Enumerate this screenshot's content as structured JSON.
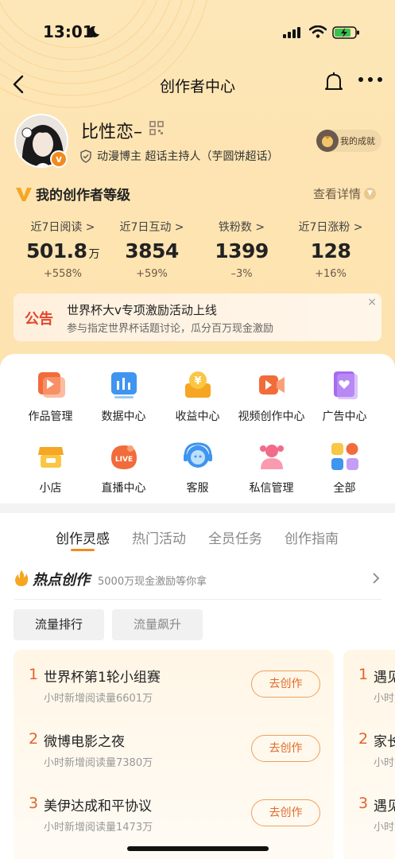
{
  "status_bar": {
    "time": "13:01"
  },
  "nav": {
    "title": "创作者中心"
  },
  "profile": {
    "username": "比性恋–",
    "verification": "动漫博主 超话主持人（芋圆饼超话）",
    "achievement": "我的成就",
    "avatar_badge": "v"
  },
  "level": {
    "title": "我的创作者等级",
    "detail": "查看详情"
  },
  "stats": [
    {
      "label": "近7日阅读 >",
      "value": "501.8",
      "unit": "万",
      "change": "+558%"
    },
    {
      "label": "近7日互动 >",
      "value": "3854",
      "unit": "",
      "change": "+59%"
    },
    {
      "label": "铁粉数 >",
      "value": "1399",
      "unit": "",
      "change": "–3%"
    },
    {
      "label": "近7日涨粉 >",
      "value": "128",
      "unit": "",
      "change": "+16%"
    }
  ],
  "notice": {
    "tag": "公告",
    "title": "世界杯大v专项激励活动上线",
    "subtitle": "参与指定世界杯话题讨论，瓜分百万现金激励",
    "close": "×"
  },
  "grid": [
    {
      "label": "作品管理",
      "icon": "works-icon"
    },
    {
      "label": "数据中心",
      "icon": "data-icon"
    },
    {
      "label": "收益中心",
      "icon": "income-icon"
    },
    {
      "label": "视频创作中心",
      "icon": "video-icon"
    },
    {
      "label": "广告中心",
      "icon": "ad-icon"
    },
    {
      "label": "小店",
      "icon": "shop-icon"
    },
    {
      "label": "直播中心",
      "icon": "live-icon"
    },
    {
      "label": "客服",
      "icon": "service-icon"
    },
    {
      "label": "私信管理",
      "icon": "message-icon"
    },
    {
      "label": "全部",
      "icon": "all-icon"
    }
  ],
  "live_badge": "LIVE",
  "income_glyph": "¥",
  "tabs": [
    "创作灵感",
    "热门活动",
    "全员任务",
    "创作指南"
  ],
  "hot": {
    "title": "热点创作",
    "subtitle": "5000万现金激励等你拿"
  },
  "chips": [
    "流量排行",
    "流量飙升"
  ],
  "ranking": [
    {
      "rank": "1",
      "title": "世界杯第1轮小组赛",
      "sub": "小时新增阅读量6601万",
      "button": "去创作"
    },
    {
      "rank": "2",
      "title": "微博电影之夜",
      "sub": "小时新增阅读量7380万",
      "button": "去创作"
    },
    {
      "rank": "3",
      "title": "美伊达成和平协议",
      "sub": "小时新增阅读量1473万",
      "button": "去创作"
    }
  ],
  "ranking2": [
    {
      "rank": "1",
      "title": "遇见",
      "sub": "小时"
    },
    {
      "rank": "2",
      "title": "家长",
      "sub": "小时"
    },
    {
      "rank": "3",
      "title": "遇见",
      "sub": "小时"
    }
  ],
  "colors": {
    "accent": "#f4891f",
    "hero_bg": "#fde4b2",
    "notice_red": "#e2462f"
  }
}
